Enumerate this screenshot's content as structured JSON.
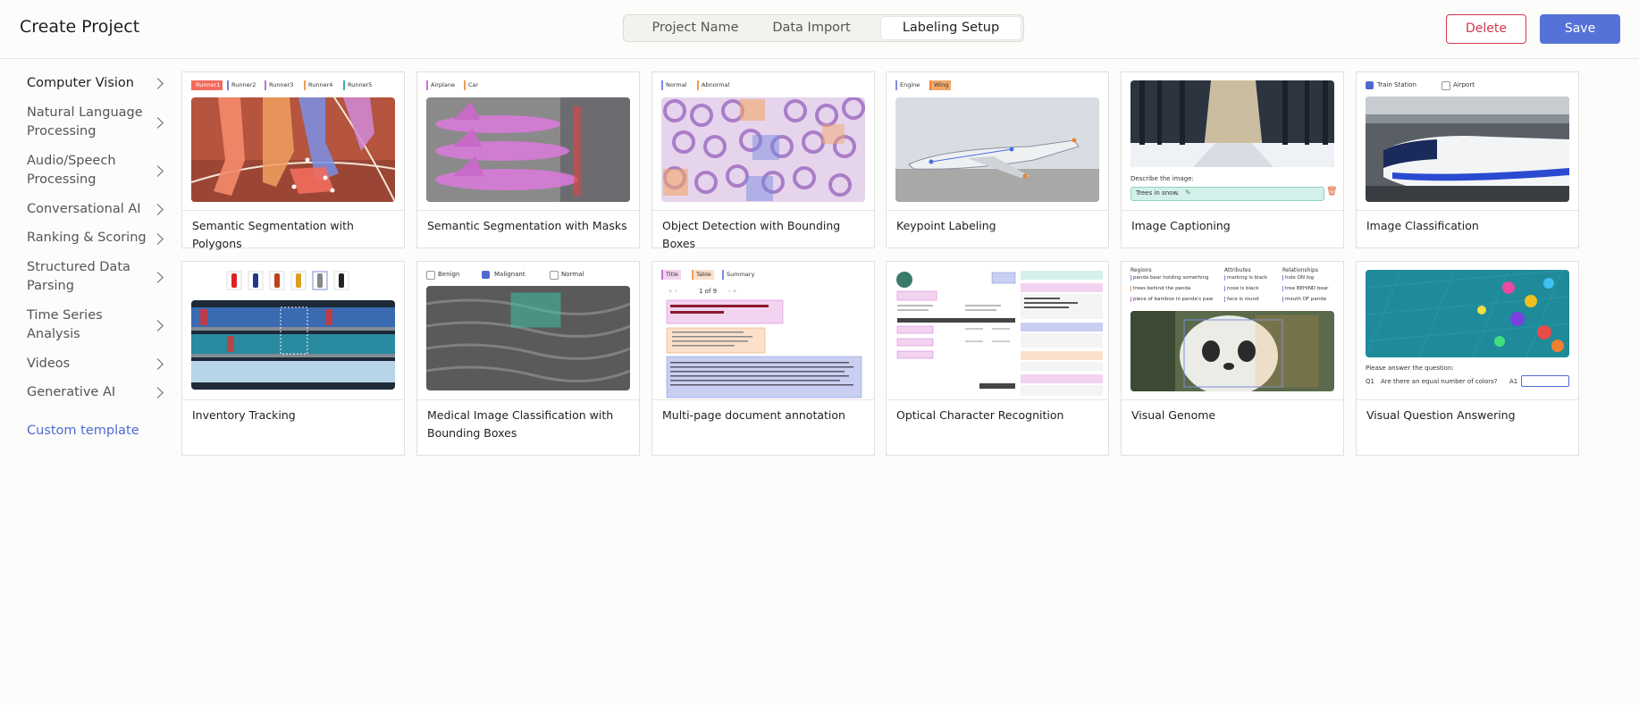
{
  "header": {
    "title": "Create Project",
    "tabs": [
      "Project Name",
      "Data Import",
      "Labeling Setup"
    ],
    "active_tab": "Labeling Setup",
    "delete_label": "Delete",
    "save_label": "Save"
  },
  "sidebar": {
    "items": [
      "Computer Vision",
      "Natural Language Processing",
      "Audio/Speech Processing",
      "Conversational AI",
      "Ranking & Scoring",
      "Structured Data Parsing",
      "Time Series Analysis",
      "Videos",
      "Generative AI"
    ],
    "custom_template": "Custom template"
  },
  "templates": [
    "Semantic Segmentation with Polygons",
    "Semantic Segmentation with Masks",
    "Object Detection with Bounding Boxes",
    "Keypoint Labeling",
    "Image Captioning",
    "Image Classification",
    "Inventory Tracking",
    "Medical Image Classification with Bounding Boxes",
    "Multi-page document annotation",
    "Optical Character Recognition",
    "Visual Genome",
    "Visual Question Answering"
  ],
  "thumbs": {
    "polygons_labels": [
      "Runner1",
      "Runner2",
      "Runner3",
      "Runner4",
      "Runner5"
    ],
    "masks_labels": [
      "Airplane",
      "Car"
    ],
    "bbox_labels": [
      "Normal",
      "Abnormal"
    ],
    "keypoint_labels": [
      "Engine",
      "Wing"
    ],
    "caption_prompt": "Describe the image:",
    "caption_value": "Trees in snow.",
    "classification_options": [
      "Train Station",
      "Airport"
    ],
    "medical_options": [
      "Benign",
      "Malignant",
      "Normal"
    ],
    "doc_labels": [
      "Title",
      "Table",
      "Summary"
    ],
    "doc_pager": "1 of 9",
    "genome_headers": [
      "Regions",
      "Attributes",
      "Relationships"
    ],
    "genome_regions": [
      "panda bear holding something",
      "trees behind the panda",
      "piece of bamboo in panda's paw"
    ],
    "genome_attributes": [
      "marking is black",
      "nose is black",
      "face is round"
    ],
    "genome_relationships": [
      "hole ON log",
      "tree BEHIND bear",
      "mouth OF panda"
    ],
    "vqa_prompt": "Please answer the question:",
    "vqa_q_label": "Q1",
    "vqa_question": "Are there an equal number of colors?",
    "vqa_a_label": "A1"
  },
  "colors": {
    "accent": "#5572d8",
    "danger": "#d1374c"
  }
}
